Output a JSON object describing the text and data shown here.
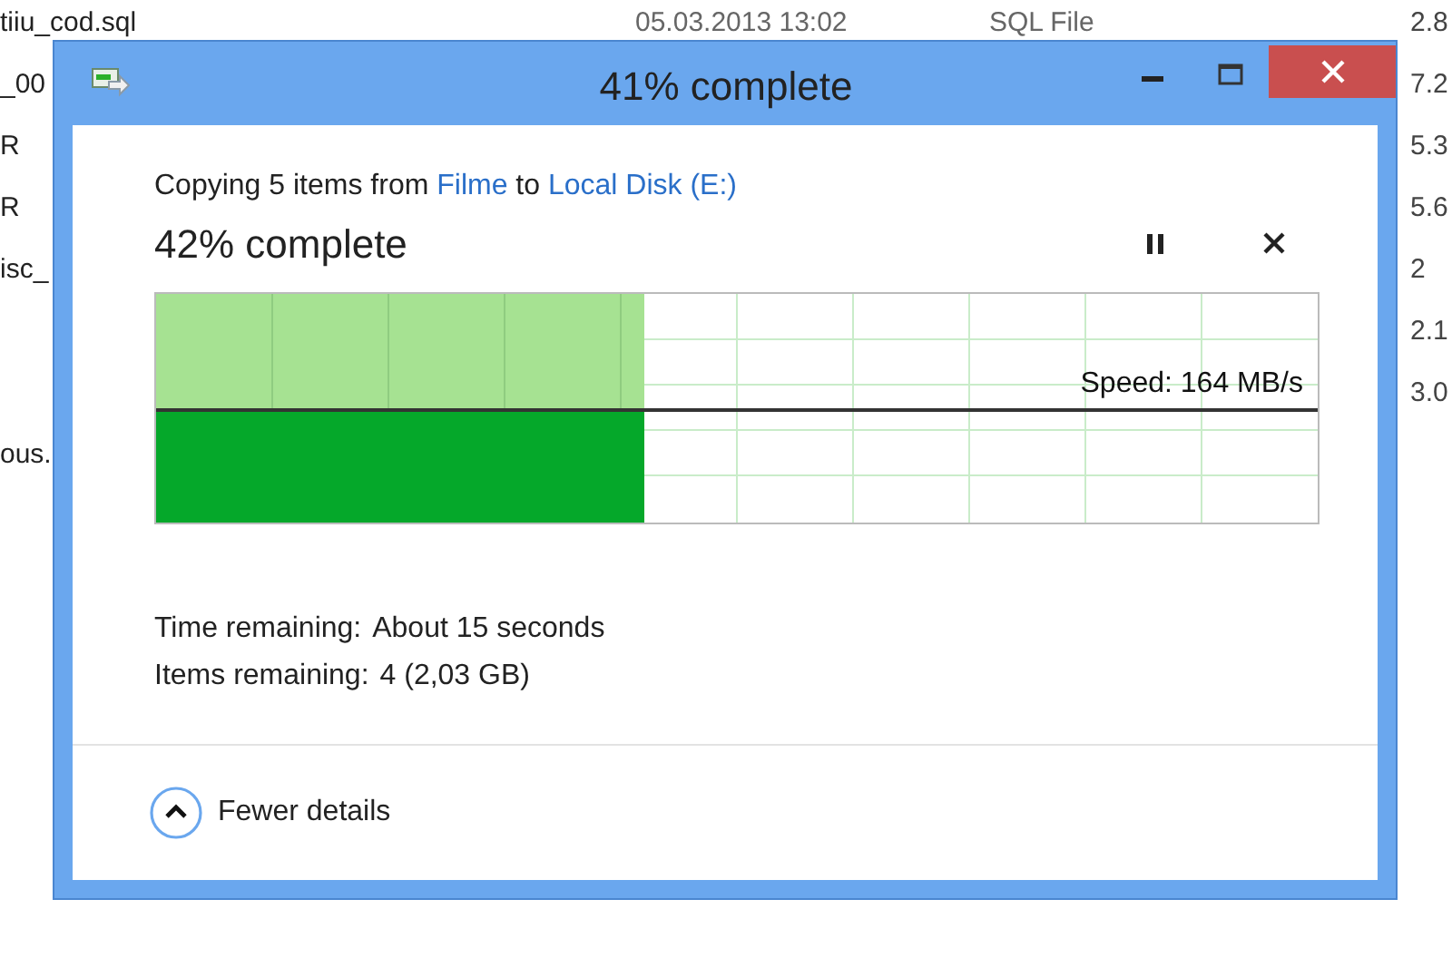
{
  "background_list": {
    "rows": [
      {
        "name": "tiiu_cod.sql",
        "date": "05.03.2013 13:02",
        "type": "SQL File",
        "size": "2.8"
      },
      {
        "name": "_00",
        "size": "7.2"
      },
      {
        "name": "R",
        "size": "5.3"
      },
      {
        "name": "R",
        "size": "5.6"
      },
      {
        "name": "isc_",
        "size": "2"
      },
      {
        "size": "2.1"
      },
      {
        "size": "3.0"
      },
      {
        "name": "ous."
      }
    ]
  },
  "dialog": {
    "title": "41% complete",
    "summary": {
      "prefix": "Copying 5 items from",
      "source": "Filme",
      "middle": "to",
      "destination": "Local Disk (E:)"
    },
    "progress_label": "42% complete",
    "level": 0.42,
    "speed": "Speed: 164 MB/s",
    "details": [
      {
        "label": "Time remaining:",
        "value": "About 15 seconds"
      },
      {
        "label": "Items remaining:",
        "value": "4 (2,03 GB)"
      }
    ],
    "toggle": {
      "label": "Fewer details",
      "expanded": true
    }
  }
}
